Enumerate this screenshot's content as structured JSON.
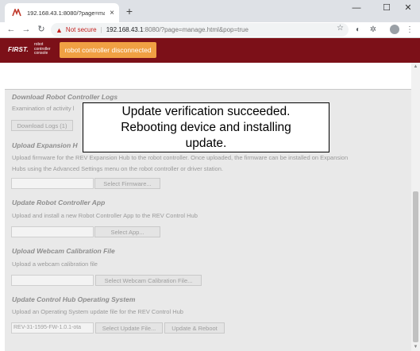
{
  "browser": {
    "tab_title": "192.168.43.1:8080/?page=manag",
    "tab_close": "×",
    "new_tab": "+",
    "window_controls": {
      "minimize": "—",
      "maximize": "☐",
      "close": "✕"
    },
    "nav": {
      "back": "←",
      "forward": "→",
      "reload": "↻"
    },
    "security_label": "Not secure",
    "url_host": "192.168.43.1",
    "url_path": ":8080/?page=manage.html&pop=true",
    "menu": "⋮"
  },
  "app": {
    "logo": "FIRST.",
    "logo_sub": "robot controller console",
    "status": "robot controller disconnected"
  },
  "sections": {
    "download_logs": {
      "title": "Download Robot Controller Logs",
      "desc": "Examination of activity l",
      "button": "Download Logs (1)"
    },
    "upload_hub": {
      "title": "Upload Expansion H",
      "desc_line1": "Upload firmware for the REV Expansion Hub to the robot controller. Once uploaded, the firmware can be installed on Expansion",
      "desc_line2": "Hubs using the Advanced Settings menu on the robot controller or driver station.",
      "button": "Select Firmware..."
    },
    "update_app": {
      "title": "Update Robot Controller App",
      "desc": "Upload and install a new Robot Controller App to the REV Control Hub",
      "button": "Select App..."
    },
    "webcam": {
      "title": "Upload Webcam Calibration File",
      "desc": "Upload a webcam calibration file",
      "button": "Select Webcam Calibration File..."
    },
    "os_update": {
      "title": "Update Control Hub Operating System",
      "desc": "Upload an Operating System update file for the REV Control Hub",
      "file_value": "REV-31-1595-FW-1.0.1-ota",
      "select_button": "Select Update File...",
      "update_button": "Update & Reboot"
    }
  },
  "dialog": {
    "line1": "Update verification succeeded.",
    "line2": "Rebooting device and installing",
    "line3": "update."
  }
}
